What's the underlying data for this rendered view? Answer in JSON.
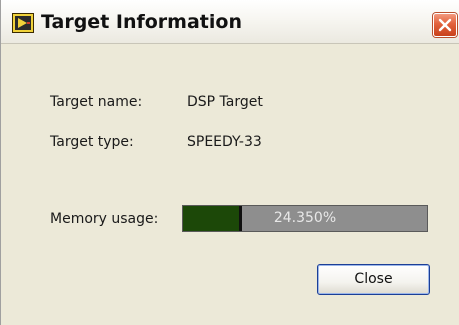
{
  "window": {
    "title": "Target Information",
    "close_icon": "close-x-icon",
    "app_icon": "labview-icon"
  },
  "fields": {
    "target_name": {
      "label": "Target name:",
      "value": "DSP Target"
    },
    "target_type": {
      "label": "Target type:",
      "value": "SPEEDY-33"
    }
  },
  "memory": {
    "label": "Memory usage:",
    "display": "24.350%",
    "percent": 24.35,
    "fill_color": "#1c4808",
    "track_color": "#8e8e8e"
  },
  "actions": {
    "close_label": "Close"
  },
  "colors": {
    "dialog_bg": "#ece9d8",
    "close_button_red": "#e2613b",
    "button_border": "#1c3f96"
  }
}
